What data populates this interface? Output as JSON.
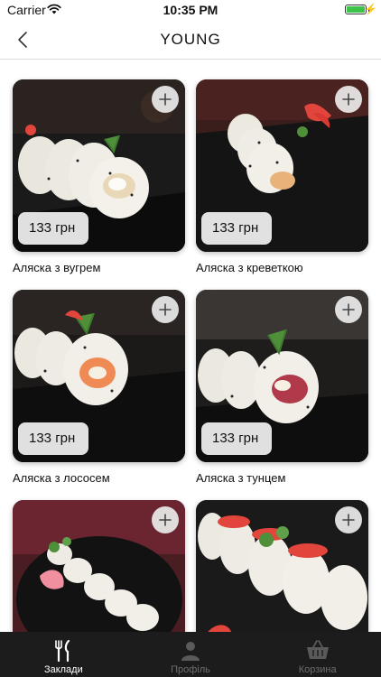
{
  "status_bar": {
    "carrier": "Carrier",
    "time": "10:35 PM"
  },
  "nav": {
    "title": "YOUNG"
  },
  "products": [
    {
      "price": "133 грн",
      "name": "Аляска з вугрем"
    },
    {
      "price": "133 грн",
      "name": "Аляска з креветкою"
    },
    {
      "price": "133 грн",
      "name": "Аляска з лососем"
    },
    {
      "price": "133 грн",
      "name": "Аляска з тунцем"
    },
    {
      "price": "",
      "name": ""
    },
    {
      "price": "",
      "name": ""
    }
  ],
  "tabs": [
    {
      "label": "Заклади",
      "icon": "fork-knife-icon",
      "active": true
    },
    {
      "label": "Профіль",
      "icon": "person-icon",
      "active": false
    },
    {
      "label": "Корзина",
      "icon": "basket-icon",
      "active": false
    }
  ],
  "colors": {
    "tab_bar_bg": "#1c1c1c",
    "active_tab": "#ffffff",
    "inactive_tab": "#6e6e6e",
    "ginger": "#e2453c",
    "battery": "#3dc24a"
  }
}
